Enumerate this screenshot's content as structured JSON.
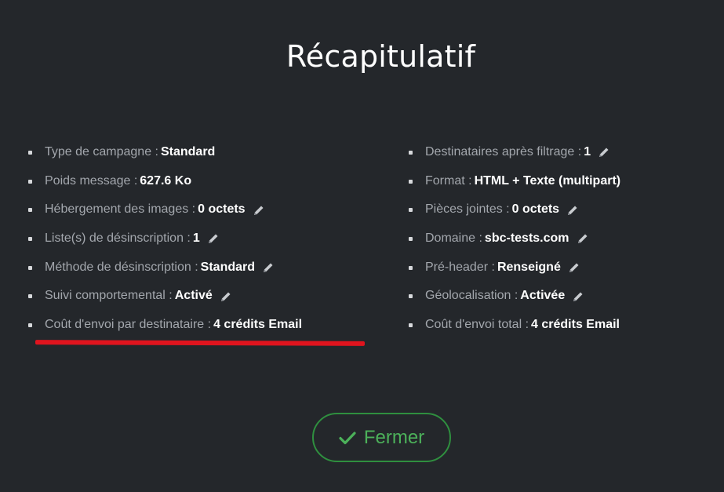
{
  "dialog": {
    "title": "Récapitulatif",
    "close_label": "Fermer",
    "colors": {
      "background": "#24272b",
      "label": "#a3a7ad",
      "value": "#ffffff",
      "accent_green": "#4cb15a",
      "highlight_red": "#e0141e"
    }
  },
  "summary": {
    "left": [
      {
        "label": "Type de campagne",
        "value": "Standard",
        "editable": false
      },
      {
        "label": "Poids message",
        "value": "627.6 Ko",
        "editable": false
      },
      {
        "label": "Hébergement des images",
        "value": "0 octets",
        "editable": true
      },
      {
        "label": "Liste(s) de désinscription",
        "value": "1",
        "editable": true
      },
      {
        "label": "Méthode de désinscription",
        "value": "Standard",
        "editable": true
      },
      {
        "label": "Suivi comportemental",
        "value": "Activé",
        "editable": true
      },
      {
        "label": "Coût d'envoi par destinataire",
        "value": "4 crédits Email",
        "editable": false,
        "highlighted": true
      }
    ],
    "right": [
      {
        "label": "Destinataires après filtrage",
        "value": "1",
        "editable": true
      },
      {
        "label": "Format",
        "value": "HTML + Texte (multipart)",
        "editable": false
      },
      {
        "label": "Pièces jointes",
        "value": "0 octets",
        "editable": true
      },
      {
        "label": "Domaine",
        "value": "sbc-tests.com",
        "editable": true
      },
      {
        "label": "Pré-header",
        "value": "Renseigné",
        "editable": true
      },
      {
        "label": "Géolocalisation",
        "value": "Activée",
        "editable": true
      },
      {
        "label": "Coût d'envoi total",
        "value": "4 crédits Email",
        "editable": false
      }
    ]
  },
  "icons": {
    "edit": "pencil-icon",
    "close": "check-icon"
  }
}
